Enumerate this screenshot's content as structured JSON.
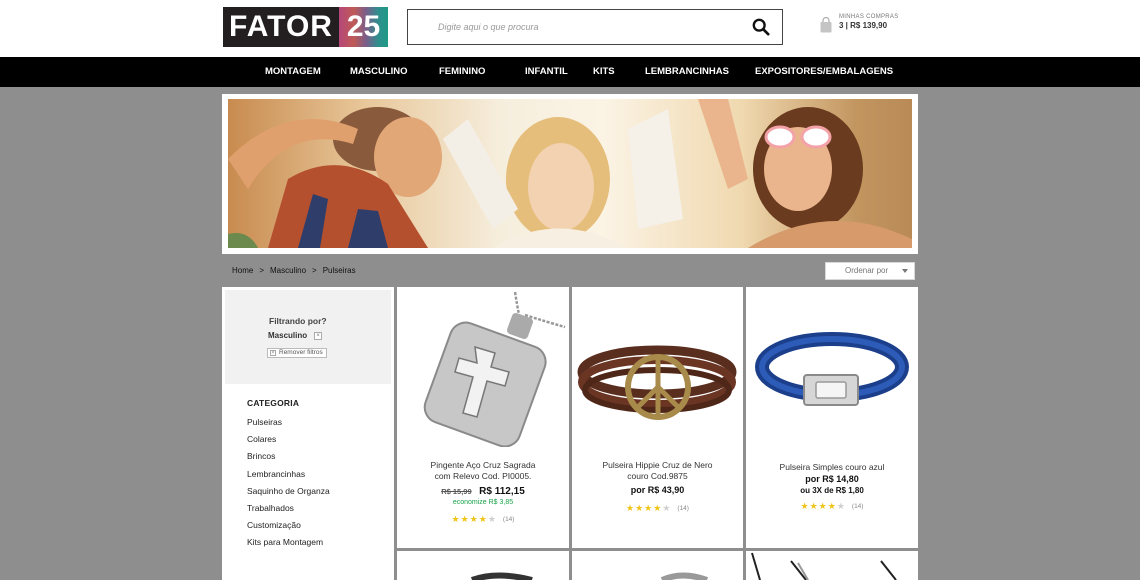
{
  "header": {
    "logo_word": "FATOR",
    "logo_number": "25",
    "top_links": [
      "",
      "",
      "",
      "",
      ""
    ],
    "search_placeholder": "Digite aqui o que procura",
    "cart_label": "MINHAS COMPRAS",
    "cart_value": "3 | R$ 139,90"
  },
  "nav": [
    "MONTAGEM",
    "MASCULINO",
    "FEMININO",
    "INFANTIL",
    "KITS",
    "LEMBRANCINHAS",
    "EXPOSITORES/EMBALAGENS"
  ],
  "breadcrumb": [
    "Home",
    ">",
    "Masculino",
    ">",
    "Pulseiras"
  ],
  "sort_label": "Ordenar por",
  "sidebar": {
    "filter_title": "Filtrando por?",
    "filter_value": "Masculino",
    "remove_filters": "Remover filtros",
    "category_title": "CATEGORIA",
    "categories": [
      "Pulseiras",
      "Colares",
      "Brincos",
      "Lembrancinhas",
      "Saquinho de Organza",
      "Trabalhados",
      "Customização",
      "Kits para Montagem"
    ]
  },
  "products": [
    {
      "name": "Pingente Aço  Cruz  Sagrada com Relevo Cod. PI0005.",
      "old_price": "R$ 15,99",
      "price": "R$ 112,15",
      "savings": "economize  R$ 3,85",
      "rating": 4,
      "reviews": "(14)",
      "image": "cross-pendant"
    },
    {
      "name": "Pulseira Hippie Cruz de Nero couro Cod.9875",
      "price": "por R$ 43,90",
      "rating": 4,
      "reviews": "(14)",
      "image": "peace-bracelet"
    },
    {
      "name": "Pulseira Simples couro azul",
      "price": "por R$ 14,80",
      "installments": "ou  3X de  R$ 1,80",
      "rating": 4,
      "reviews": "(14)",
      "image": "blue-leather-bracelet"
    }
  ],
  "colors": {
    "nav_bg": "#000000",
    "page_bg": "#8e8e8e",
    "savings_green": "#1aa34a",
    "star": "#f0c419"
  }
}
